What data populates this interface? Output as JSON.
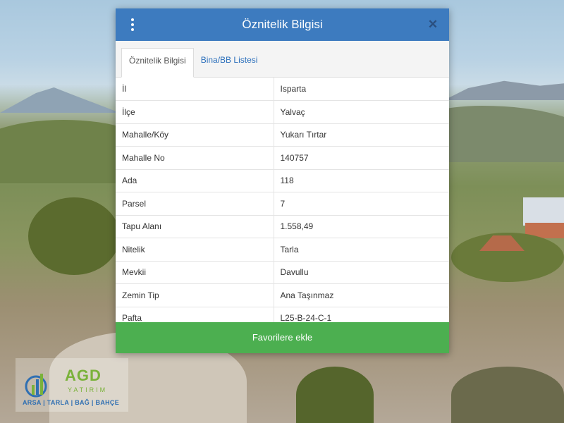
{
  "dialog": {
    "title": "Öznitelik Bilgisi",
    "menu_icon": "more-vertical-icon",
    "close_icon": "close-icon",
    "tabs": [
      {
        "label": "Öznitelik Bilgisi",
        "active": true
      },
      {
        "label": "Bina/BB Listesi",
        "active": false
      }
    ],
    "rows": [
      {
        "key": "İl",
        "value": "Isparta"
      },
      {
        "key": "İlçe",
        "value": "Yalvaç"
      },
      {
        "key": "Mahalle/Köy",
        "value": "Yukarı Tırtar"
      },
      {
        "key": "Mahalle No",
        "value": "140757"
      },
      {
        "key": "Ada",
        "value": "118"
      },
      {
        "key": "Parsel",
        "value": "7"
      },
      {
        "key": "Tapu Alanı",
        "value": "1.558,49"
      },
      {
        "key": "Nitelik",
        "value": "Tarla"
      },
      {
        "key": "Mevkii",
        "value": "Davullu"
      },
      {
        "key": "Zemin Tip",
        "value": "Ana Taşınmaz"
      },
      {
        "key": "Pafta",
        "value": "L25-B-24-C-1"
      }
    ],
    "favorite_button": "Favorilere ekle"
  },
  "logo": {
    "name": "AGD",
    "sub": "YATIRIM",
    "tagline": "ARSA | TARLA | BAĞ | BAHÇE"
  },
  "colors": {
    "header": "#3d7bbf",
    "button": "#4caf50",
    "tab_link": "#2a6ebb"
  }
}
